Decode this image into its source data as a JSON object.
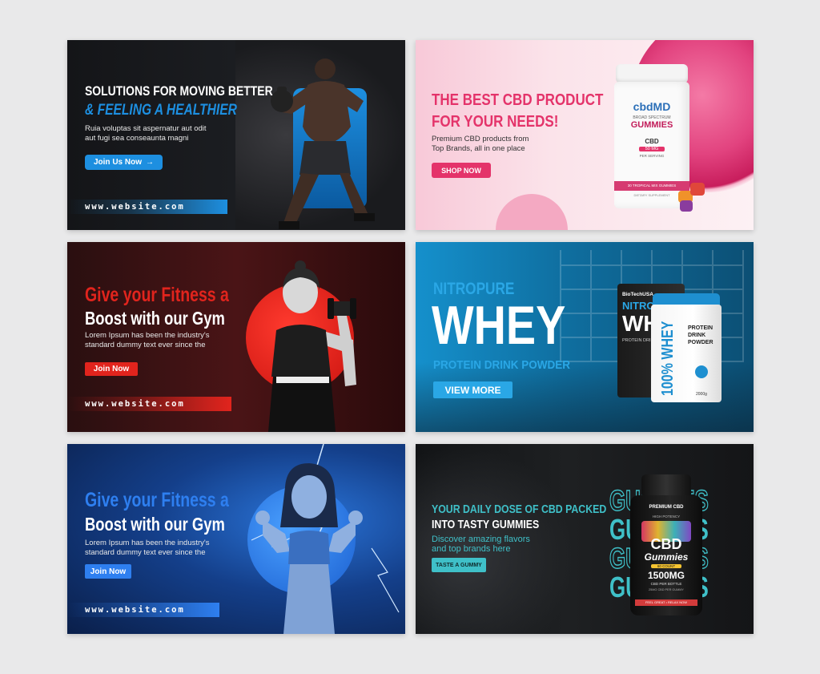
{
  "b1": {
    "title_line1": "SOLUTIONS FOR MOVING BETTER",
    "title_line2": "& FEELING A HEALTHIER",
    "body_line1": "Ruia voluptas sit aspernatur aut odit",
    "body_line2": "aut fugi sea conseaunta magni",
    "button": "Join Us Now",
    "website": "www.website.com",
    "accent": "#1d8fe0"
  },
  "b2": {
    "title_line1": "THE BEST CBD PRODUCT",
    "title_line2": "FOR YOUR NEEDS!",
    "body_line1": "Premium CBD products from",
    "body_line2": "Top Brands, all in one place",
    "button": "SHOP NOW",
    "accent": "#e4336a",
    "jar": {
      "brand": "cbdMD",
      "sub": "BROAD SPECTRUM",
      "name": "GUMMIES",
      "cbd": "CBD",
      "mg": "50 MG",
      "per": "PER SERVING",
      "count": "30 TROPICAL MIX GUMMIES",
      "footer": "DIETARY SUPPLEMENT"
    }
  },
  "b3": {
    "title_line1": "Give your Fitness a",
    "title_line2": "Boost with our Gym",
    "body_line1": "Lorem Ipsum has been the industry's",
    "body_line2": "standard dummy text ever since the",
    "button": "Join Now",
    "website": "www.website.com",
    "accent": "#e1241d"
  },
  "b4": {
    "kicker": "NITROPURE",
    "title": "WHEY",
    "subtitle": "PROTEIN DRINK POWDER",
    "button": "VIEW MORE",
    "accent": "#2aa7e6",
    "pack": {
      "brand": "BioTechUSA",
      "name": "NITRO",
      "big": "WH",
      "sub": "PROTEIN DRINK"
    },
    "tub": {
      "big": "100% WHEY",
      "line1": "PROTEIN",
      "line2": "DRINK",
      "line3": "POWDER",
      "weight": "2000g"
    }
  },
  "b5": {
    "title_line1": "Give your Fitness a",
    "title_line2": "Boost with our Gym",
    "body_line1": "Lorem Ipsum has been the industry's",
    "body_line2": "standard dummy text ever since the",
    "button": "Join Now",
    "website": "www.website.com",
    "accent": "#2e7ff0"
  },
  "b6": {
    "title_line1": "YOUR DAILY DOSE OF CBD PACKED",
    "title_line2": "INTO TASTY GUMMIES",
    "body_line1": "Discover amazing flavors",
    "body_line2": "and top brands here",
    "button": "TASTE A GUMMY",
    "bg_word": "GUMMIES",
    "accent": "#3fc0c8",
    "jar": {
      "top": "PREMIUM CBD",
      "potency": "HIGH POTENCY",
      "cbd": "CBD",
      "gummies": "Gummies",
      "count": "60 COUNT",
      "mg": "1500MG",
      "per": "CBD PER BOTTLE",
      "small": "25MG CBD PER GUMMY",
      "footer": "FEEL GREAT • RELAX NOW"
    }
  }
}
